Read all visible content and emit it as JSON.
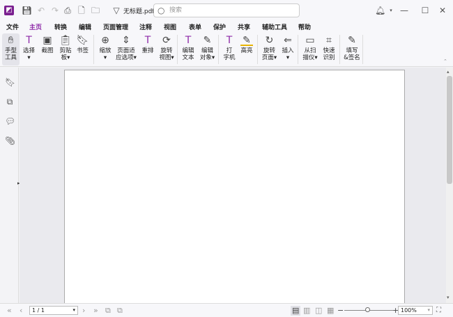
{
  "title": {
    "file_name": "无标题.pdf *",
    "search_placeholder": "搜索"
  },
  "menu": [
    "文件",
    "主页",
    "转换",
    "编辑",
    "页面管理",
    "注释",
    "视图",
    "表单",
    "保护",
    "共享",
    "辅助工具",
    "帮助"
  ],
  "ribbon": [
    {
      "l1": "手型",
      "l2": "工具",
      "icon": "hand-icon"
    },
    {
      "l1": "选择",
      "l2": "▾",
      "icon": "select-text-icon"
    },
    {
      "l1": "截图",
      "l2": "",
      "icon": "screenshot-icon"
    },
    {
      "l1": "剪贴",
      "l2": "板▾",
      "icon": "clipboard-icon"
    },
    {
      "l1": "书签",
      "l2": "",
      "icon": "bookmark-icon"
    },
    {
      "l1": "缩放",
      "l2": "▾",
      "icon": "zoom-icon"
    },
    {
      "l1": "页面适",
      "l2": "应选项▾",
      "icon": "fit-page-icon"
    },
    {
      "l1": "重排",
      "l2": "",
      "icon": "reflow-icon"
    },
    {
      "l1": "旋转",
      "l2": "视图▾",
      "icon": "rotate-view-icon"
    },
    {
      "l1": "编辑",
      "l2": "文本",
      "icon": "edit-text-icon"
    },
    {
      "l1": "编辑",
      "l2": "对象▾",
      "icon": "edit-object-icon"
    },
    {
      "l1": "打",
      "l2": "字机",
      "icon": "typewriter-icon"
    },
    {
      "l1": "高亮",
      "l2": "",
      "icon": "highlight-icon"
    },
    {
      "l1": "旋转",
      "l2": "页面▾",
      "icon": "rotate-page-icon"
    },
    {
      "l1": "插入",
      "l2": "▾",
      "icon": "insert-icon"
    },
    {
      "l1": "从扫",
      "l2": "描仪▾",
      "icon": "scanner-icon"
    },
    {
      "l1": "快速",
      "l2": "识别",
      "icon": "ocr-icon"
    },
    {
      "l1": "填写",
      "l2": "&签名",
      "icon": "fill-sign-icon"
    }
  ],
  "status": {
    "page": "1 / 1",
    "zoom": "100%",
    "zoom_level_percent": 100
  },
  "colors": {
    "accent": "#8e2aa8"
  }
}
